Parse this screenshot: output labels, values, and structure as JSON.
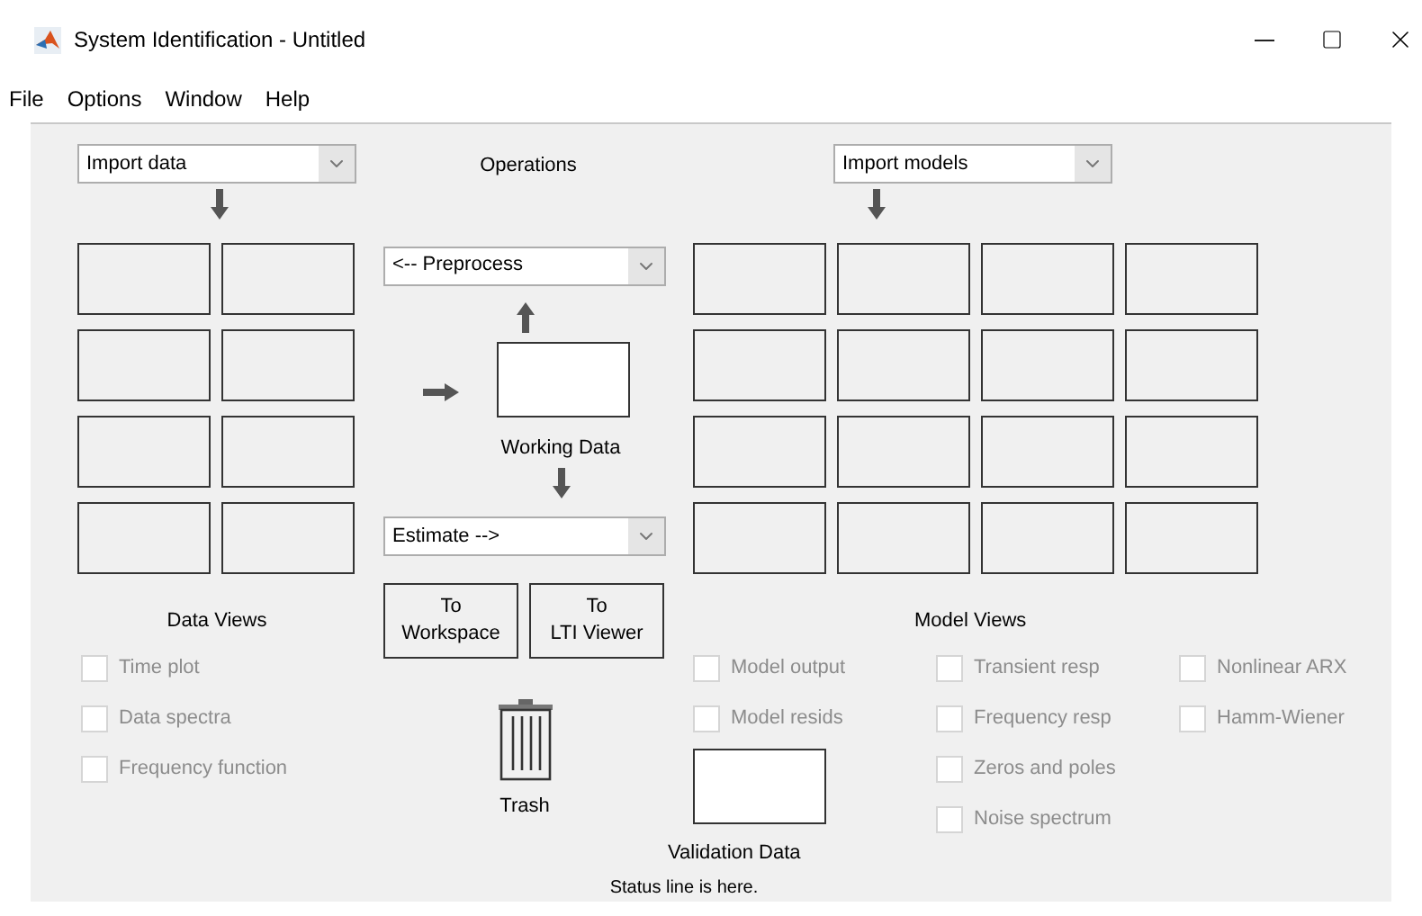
{
  "window": {
    "title": "System Identification - Untitled"
  },
  "menu": [
    "File",
    "Options",
    "Window",
    "Help"
  ],
  "data_panel": {
    "import_dropdown": "Import data",
    "views_label": "Data Views",
    "views": [
      {
        "label": "Time plot",
        "checked": false,
        "disabled": true
      },
      {
        "label": "Data spectra",
        "checked": false,
        "disabled": true
      },
      {
        "label": "Frequency function",
        "checked": false,
        "disabled": true
      }
    ]
  },
  "operations": {
    "label": "Operations",
    "preprocess": "<-- Preprocess",
    "working_data_label": "Working Data",
    "estimate": "Estimate -->",
    "buttons": [
      {
        "lines": [
          "To",
          "Workspace"
        ]
      },
      {
        "lines": [
          "To",
          "LTI Viewer"
        ]
      }
    ],
    "trash_label": "Trash"
  },
  "model_panel": {
    "import_dropdown": "Import models",
    "views_label": "Model Views",
    "validation_label": "Validation Data",
    "view_columns": [
      {
        "items": [
          {
            "label": "Model output",
            "checked": false,
            "disabled": true
          },
          {
            "label": "Model resids",
            "checked": false,
            "disabled": true
          }
        ]
      },
      {
        "items": [
          {
            "label": "Transient resp",
            "checked": false,
            "disabled": true
          },
          {
            "label": "Frequency resp",
            "checked": false,
            "disabled": true
          },
          {
            "label": "Zeros and poles",
            "checked": false,
            "disabled": true
          },
          {
            "label": "Noise spectrum",
            "checked": false,
            "disabled": true
          }
        ]
      },
      {
        "items": [
          {
            "label": "Nonlinear ARX",
            "checked": false,
            "disabled": true
          },
          {
            "label": "Hamm-Wiener",
            "checked": false,
            "disabled": true
          }
        ]
      }
    ]
  },
  "status_bar": "Status line is here."
}
